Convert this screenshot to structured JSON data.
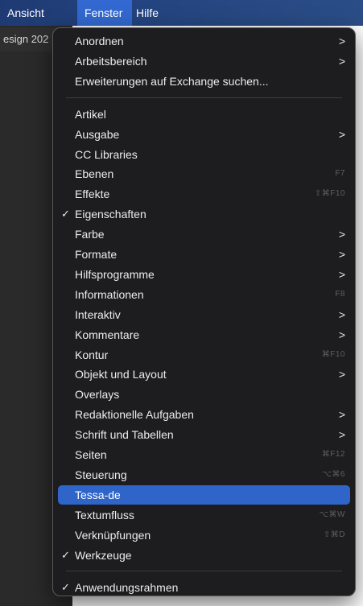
{
  "menubar": {
    "items": [
      "Ansicht",
      "Fenster",
      "Hilfe"
    ],
    "active": "Fenster"
  },
  "document": {
    "tab_title": "esign 202"
  },
  "menu": {
    "groups": [
      [
        {
          "label": "Anordnen",
          "submenu": true
        },
        {
          "label": "Arbeitsbereich",
          "submenu": true
        },
        {
          "label": "Erweiterungen auf Exchange suchen...",
          "submenu": false
        }
      ],
      [
        {
          "label": "Artikel"
        },
        {
          "label": "Ausgabe",
          "submenu": true
        },
        {
          "label": "CC Libraries"
        },
        {
          "label": "Ebenen",
          "shortcut": "F7"
        },
        {
          "label": "Effekte",
          "shortcut": "⇧⌘F10"
        },
        {
          "label": "Eigenschaften",
          "checked": true
        },
        {
          "label": "Farbe",
          "submenu": true
        },
        {
          "label": "Formate",
          "submenu": true
        },
        {
          "label": "Hilfsprogramme",
          "submenu": true
        },
        {
          "label": "Informationen",
          "shortcut": "F8"
        },
        {
          "label": "Interaktiv",
          "submenu": true
        },
        {
          "label": "Kommentare",
          "submenu": true
        },
        {
          "label": "Kontur",
          "shortcut": "⌘F10"
        },
        {
          "label": "Objekt und Layout",
          "submenu": true
        },
        {
          "label": "Overlays"
        },
        {
          "label": "Redaktionelle Aufgaben",
          "submenu": true
        },
        {
          "label": "Schrift und Tabellen",
          "submenu": true
        },
        {
          "label": "Seiten",
          "shortcut": "⌘F12"
        },
        {
          "label": "Steuerung",
          "shortcut": "⌥⌘6"
        },
        {
          "label": "Tessa-de",
          "selected": true
        },
        {
          "label": "Textumfluss",
          "shortcut": "⌥⌘W"
        },
        {
          "label": "Verknüpfungen",
          "shortcut": "⇧⌘D"
        },
        {
          "label": "Werkzeuge",
          "checked": true
        }
      ],
      [
        {
          "label": "Anwendungsrahmen",
          "checked": true
        }
      ]
    ],
    "arrow_glyph": ">",
    "check_glyph": "✓"
  },
  "colors": {
    "menubar": "#24447f",
    "menubar_active": "#3268cf",
    "menu_bg": "#1d1d1f",
    "selection": "#2f64c9"
  }
}
